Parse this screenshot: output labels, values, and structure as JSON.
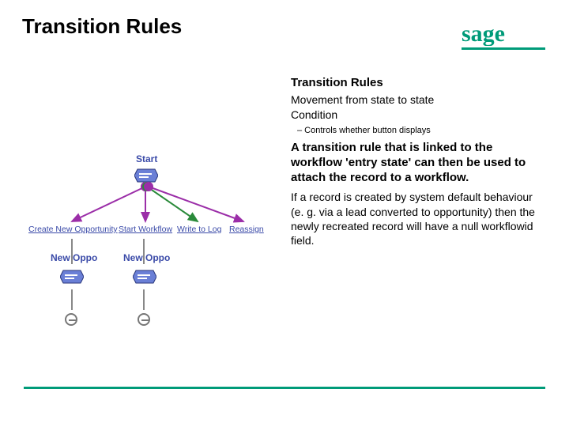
{
  "page_title": "Transition Rules",
  "logo": {
    "text": "sage",
    "color": "#009b79"
  },
  "content": {
    "subheading": "Transition Rules",
    "line1": "Movement from state to state",
    "line2": "Condition",
    "sub_bullet": "–  Controls whether button displays",
    "bold_paragraph": "A transition rule that is linked to the workflow 'entry state' can then be used to attach the record to a workflow.",
    "paragraph": "If a  record is created by system default behaviour (e. g. via a lead converted to opportunity) then the newly recreated record will have a null workflowid field."
  },
  "diagram": {
    "start_label": "Start",
    "actions": {
      "create_new_opportunity": "Create New Opportunity",
      "start_workflow": "Start Workflow",
      "write_to_log": "Write to Log",
      "reassign": "Reassign"
    },
    "new_oppo_label": "New Oppo"
  }
}
